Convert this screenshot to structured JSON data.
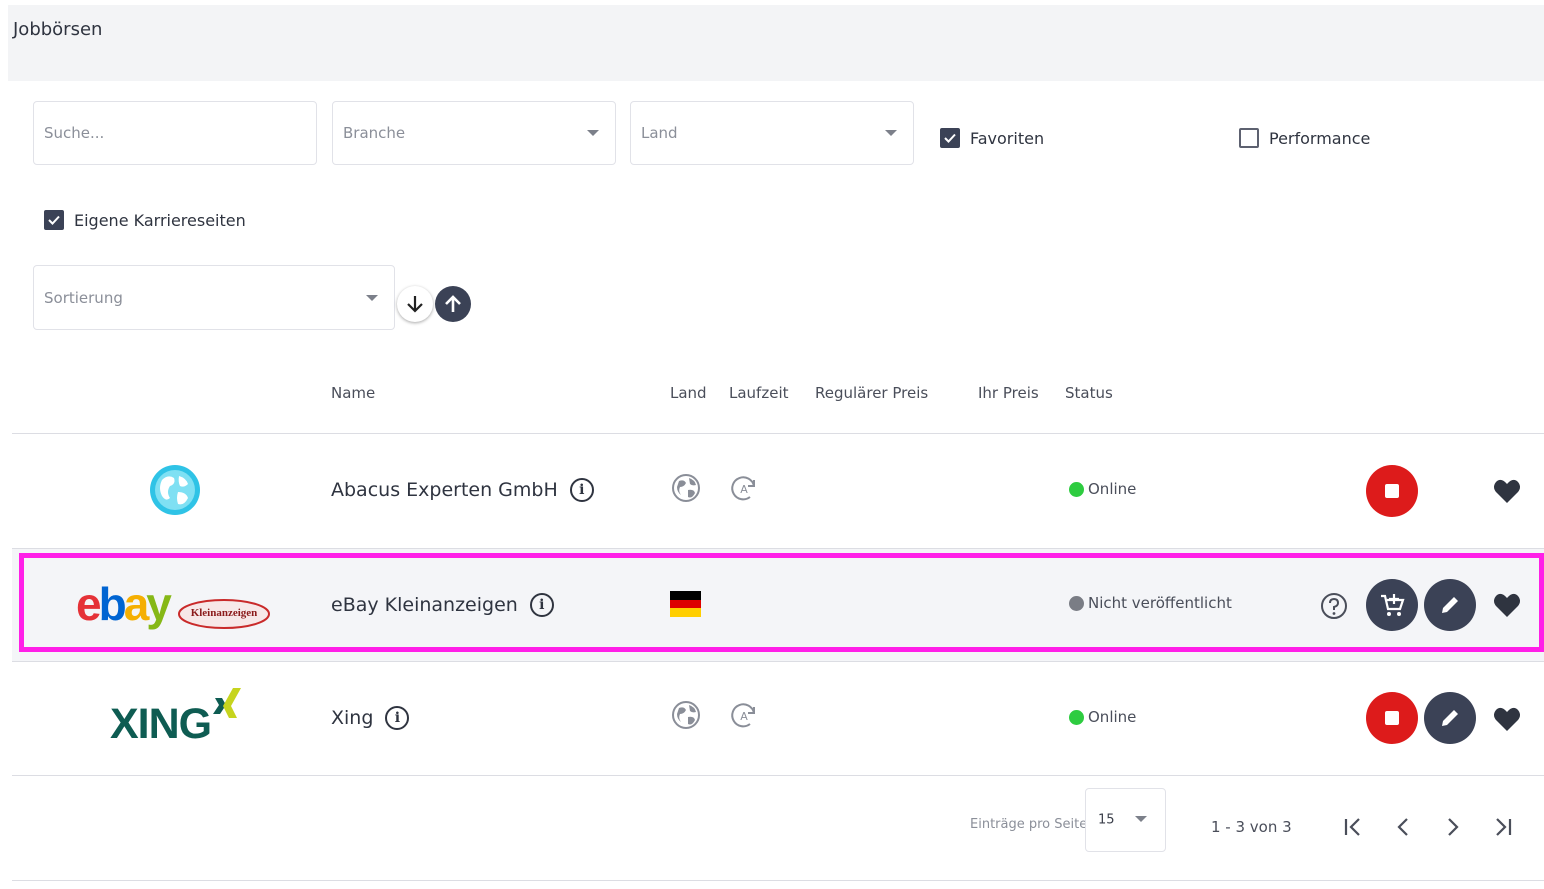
{
  "header": {
    "title": "Jobbörsen"
  },
  "filters": {
    "search_placeholder": "Suche...",
    "branche_placeholder": "Branche",
    "land_placeholder": "Land",
    "favoriten": {
      "label": "Favoriten",
      "checked": true
    },
    "performance": {
      "label": "Performance",
      "checked": false
    },
    "eigene": {
      "label": "Eigene Karriereseiten",
      "checked": true
    },
    "sort_placeholder": "Sortierung"
  },
  "columns": {
    "name": "Name",
    "land": "Land",
    "laufzeit": "Laufzeit",
    "regulaerer_preis": "Regulärer Preis",
    "ihr_preis": "Ihr Preis",
    "status": "Status"
  },
  "rows": [
    {
      "name": "Abacus Experten GmbH",
      "land_icon": "globe-icon",
      "laufzeit_icon": "auto-renew-icon",
      "status": "Online",
      "status_color": "#2ecc40",
      "actions": [
        "stop",
        "favorite"
      ]
    },
    {
      "name": "eBay Kleinanzeigen",
      "land_icon": "germany-flag",
      "logo_text": "ebay",
      "logo_badge": "Kleinanzeigen",
      "status": "Nicht veröffentlicht",
      "status_color": "#7a7d85",
      "actions": [
        "help",
        "add-to-cart",
        "edit",
        "favorite"
      ]
    },
    {
      "name": "Xing",
      "land_icon": "globe-icon",
      "laufzeit_icon": "auto-renew-icon",
      "logo_text": "XING",
      "status": "Online",
      "status_color": "#2ecc40",
      "actions": [
        "stop",
        "edit",
        "favorite"
      ]
    }
  ],
  "pagination": {
    "per_page_label": "Einträge pro Seite",
    "per_page_value": "15",
    "range": "1 - 3 von 3"
  },
  "colors": {
    "accent_dark": "#3b4256",
    "stop_red": "#dd1b1b",
    "highlight": "#ff1fe8",
    "online_green": "#2ecc40"
  }
}
